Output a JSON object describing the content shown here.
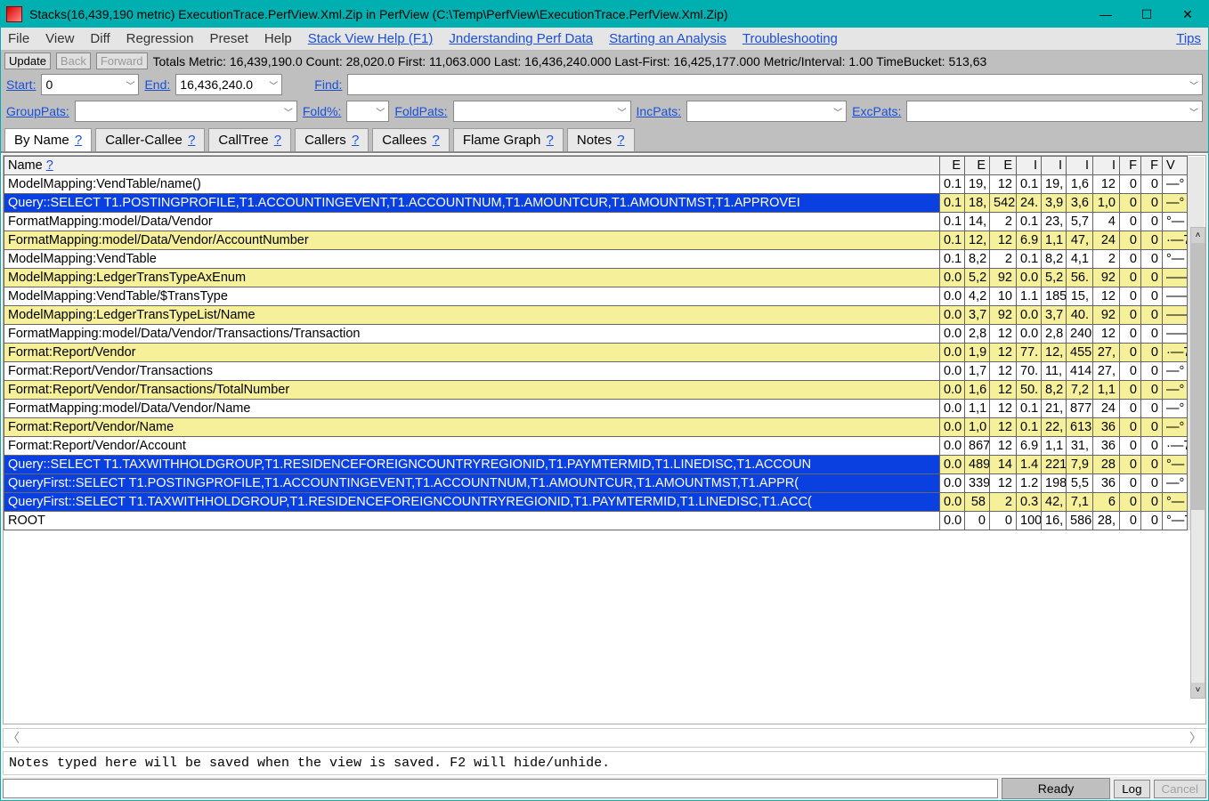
{
  "window_title": "Stacks(16,439,190 metric) ExecutionTrace.PerfView.Xml.Zip in PerfView (C:\\Temp\\PerfView\\ExecutionTrace.PerfView.Xml.Zip)",
  "menubar": {
    "items": [
      "File",
      "View",
      "Diff",
      "Regression",
      "Preset",
      "Help"
    ],
    "links": [
      "Stack View Help (F1)",
      "Jnderstanding Perf Data",
      "Starting an Analysis",
      "Troubleshooting",
      "Tips"
    ]
  },
  "toolbar": {
    "update": "Update",
    "back": "Back",
    "forward": "Forward",
    "totals": "Totals Metric: 16,439,190.0   Count: 28,020.0   First: 11,063.000 Last: 16,436,240.000   Last-First: 16,425,177.000   Metric/Interval: 1.00   TimeBucket: 513,63"
  },
  "filters1": {
    "start_label": "Start:",
    "start_value": "0",
    "end_label": "End:",
    "end_value": "16,436,240.0",
    "find_label": "Find:",
    "find_value": ""
  },
  "filters2": {
    "grouppats_label": "GroupPats:",
    "foldpct_label": "Fold%:",
    "foldpats_label": "FoldPats:",
    "incpats_label": "IncPats:",
    "excpats_label": "ExcPats:"
  },
  "tabs": [
    "By Name",
    "Caller-Callee",
    "CallTree",
    "Callers",
    "Callees",
    "Flame Graph",
    "Notes"
  ],
  "active_tab": 0,
  "columns": [
    "Name ?",
    "E",
    "E",
    "E",
    "I",
    "I",
    "I",
    "I",
    "F",
    "F",
    "V"
  ],
  "rows": [
    {
      "name": "ModelMapping:VendTable/name()",
      "cells": [
        "0.1",
        "19,",
        "12",
        "0.1",
        "19,",
        "1,6",
        "12",
        "0",
        "0",
        "—°"
      ],
      "alt": false,
      "sel": false
    },
    {
      "name": "Query::SELECT T1.POSTINGPROFILE,T1.ACCOUNTINGEVENT,T1.ACCOUNTNUM,T1.AMOUNTCUR,T1.AMOUNTMST,T1.APPROVEI",
      "cells": [
        "0.1",
        "18,",
        "542",
        "24.",
        "3,9",
        "3,6",
        "1,0",
        "0",
        "0",
        "—°"
      ],
      "alt": true,
      "sel": true
    },
    {
      "name": "FormatMapping:model/Data/Vendor",
      "cells": [
        "0.1",
        "14,",
        "2",
        "0.1",
        "23,",
        "5,7",
        "4",
        "0",
        "0",
        "°—"
      ],
      "alt": false,
      "sel": false
    },
    {
      "name": "FormatMapping:model/Data/Vendor/AccountNumber",
      "cells": [
        "0.1",
        "12,",
        "12",
        "6.9",
        "1,1",
        "47,",
        "24",
        "0",
        "0",
        "·—7"
      ],
      "alt": true,
      "sel": false
    },
    {
      "name": "ModelMapping:VendTable",
      "cells": [
        "0.1",
        "8,2",
        "2",
        "0.1",
        "8,2",
        "4,1",
        "2",
        "0",
        "0",
        "°—"
      ],
      "alt": false,
      "sel": false
    },
    {
      "name": "ModelMapping:LedgerTransTypeAxEnum",
      "cells": [
        "0.0",
        "5,2",
        "92",
        "0.0",
        "5,2",
        "56.",
        "92",
        "0",
        "0",
        "——"
      ],
      "alt": true,
      "sel": false
    },
    {
      "name": "ModelMapping:VendTable/$TransType",
      "cells": [
        "0.0",
        "4,2",
        "10",
        "1.1",
        "185",
        "15,",
        "12",
        "0",
        "0",
        "——"
      ],
      "alt": false,
      "sel": false
    },
    {
      "name": "ModelMapping:LedgerTransTypeList/Name",
      "cells": [
        "0.0",
        "3,7",
        "92",
        "0.0",
        "3,7",
        "40.",
        "92",
        "0",
        "0",
        "——"
      ],
      "alt": true,
      "sel": false
    },
    {
      "name": "FormatMapping:model/Data/Vendor/Transactions/Transaction",
      "cells": [
        "0.0",
        "2,8",
        "12",
        "0.0",
        "2,8",
        "240",
        "12",
        "0",
        "0",
        "——"
      ],
      "alt": false,
      "sel": false
    },
    {
      "name": "Format:Report/Vendor",
      "cells": [
        "0.0",
        "1,9",
        "12",
        "77.",
        "12,",
        "455",
        "27,",
        "0",
        "0",
        "·—7"
      ],
      "alt": true,
      "sel": false
    },
    {
      "name": "Format:Report/Vendor/Transactions",
      "cells": [
        "0.0",
        "1,7",
        "12",
        "70.",
        "11,",
        "414",
        "27,",
        "0",
        "0",
        "—°"
      ],
      "alt": false,
      "sel": false
    },
    {
      "name": "Format:Report/Vendor/Transactions/TotalNumber",
      "cells": [
        "0.0",
        "1,6",
        "12",
        "50.",
        "8,2",
        "7,2",
        "1,1",
        "0",
        "0",
        "—°"
      ],
      "alt": true,
      "sel": false
    },
    {
      "name": "FormatMapping:model/Data/Vendor/Name",
      "cells": [
        "0.0",
        "1,1",
        "12",
        "0.1",
        "21,",
        "877",
        "24",
        "0",
        "0",
        "—°"
      ],
      "alt": false,
      "sel": false
    },
    {
      "name": "Format:Report/Vendor/Name",
      "cells": [
        "0.0",
        "1,0",
        "12",
        "0.1",
        "22,",
        "613",
        "36",
        "0",
        "0",
        "—°"
      ],
      "alt": true,
      "sel": false
    },
    {
      "name": "Format:Report/Vendor/Account",
      "cells": [
        "0.0",
        "867",
        "12",
        "6.9",
        "1,1",
        "31,",
        "36",
        "0",
        "0",
        "·—7"
      ],
      "alt": false,
      "sel": false
    },
    {
      "name": "Query::SELECT T1.TAXWITHHOLDGROUP,T1.RESIDENCEFOREIGNCOUNTRYREGIONID,T1.PAYMTERMID,T1.LINEDISC,T1.ACCOUN",
      "cells": [
        "0.0",
        "489",
        "14",
        "1.4",
        "221",
        "7,9",
        "28",
        "0",
        "0",
        "°—"
      ],
      "alt": true,
      "sel": true
    },
    {
      "name": "QueryFirst::SELECT T1.POSTINGPROFILE,T1.ACCOUNTINGEVENT,T1.ACCOUNTNUM,T1.AMOUNTCUR,T1.AMOUNTMST,T1.APPR(",
      "cells": [
        "0.0",
        "339",
        "12",
        "1.2",
        "198",
        "5,5",
        "36",
        "0",
        "0",
        "—°"
      ],
      "alt": false,
      "sel": true
    },
    {
      "name": "QueryFirst::SELECT T1.TAXWITHHOLDGROUP,T1.RESIDENCEFOREIGNCOUNTRYREGIONID,T1.PAYMTERMID,T1.LINEDISC,T1.ACC(",
      "cells": [
        "0.0",
        "58",
        "2",
        "0.3",
        "42,",
        "7,1",
        "6",
        "0",
        "0",
        "°—"
      ],
      "alt": true,
      "sel": true
    },
    {
      "name": "ROOT",
      "cells": [
        "0.0",
        "0",
        "0",
        "100",
        "16,",
        "586",
        "28,",
        "0",
        "0",
        "°—7"
      ],
      "alt": false,
      "sel": false
    }
  ],
  "notes_placeholder": "Notes typed here will be saved when the view is saved. F2 will hide/unhide.",
  "status": {
    "ready": "Ready",
    "log": "Log",
    "cancel": "Cancel"
  }
}
